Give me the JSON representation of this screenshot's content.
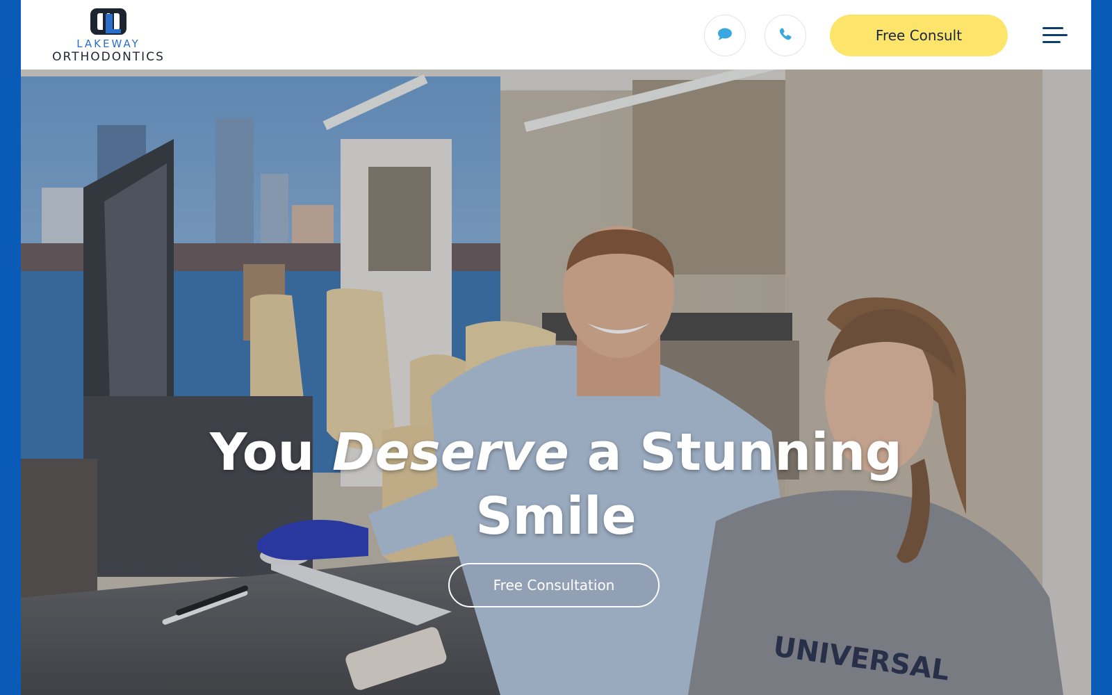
{
  "brand": {
    "logo_top": "LAKEWAY",
    "logo_bottom": "ORTHODONTICS",
    "mark_icon": "lakeway-logo-mark-icon",
    "accent": "#2a6fc9"
  },
  "header": {
    "chat_icon": "chat-bubble-icon",
    "phone_icon": "phone-icon",
    "consult_label": "Free Consult",
    "menu_icon": "hamburger-menu-icon",
    "consult_color": "#fde56b"
  },
  "hero": {
    "title_part1": "You",
    "title_emphasis": "Deserve",
    "title_part2": "a Stunning",
    "title_line2": "Smile",
    "cta_label": "Free Consultation"
  },
  "colors": {
    "page_border": "#0a5ab8",
    "icon_blue": "#3aa7e0",
    "dark_navy": "#0d3d6b"
  }
}
